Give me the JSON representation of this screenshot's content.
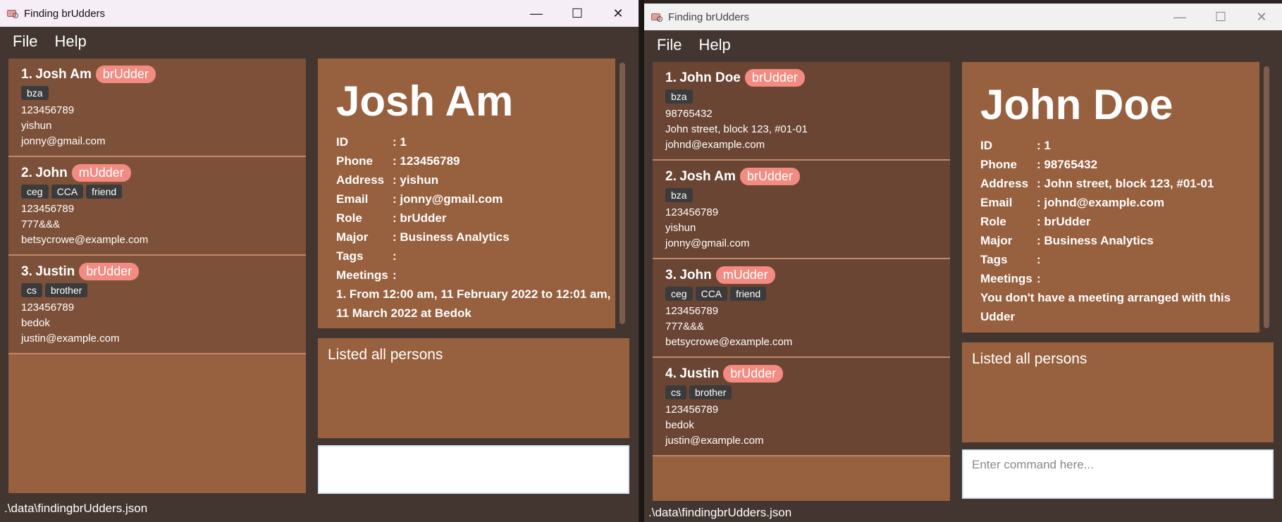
{
  "left": {
    "title": "Finding brUdders",
    "menu": [
      "File",
      "Help"
    ],
    "persons": [
      {
        "num": "1.",
        "name": "Josh Am",
        "role": "brUdder",
        "tags": [
          "bza"
        ],
        "phone": "123456789",
        "address": "yishun",
        "email": "jonny@gmail.com"
      },
      {
        "num": "2.",
        "name": "John",
        "role": "mUdder",
        "tags": [
          "ceg",
          "CCA",
          "friend"
        ],
        "phone": "123456789",
        "address": "777&&&",
        "email": "betsycrowe@example.com"
      },
      {
        "num": "3.",
        "name": "Justin",
        "role": "brUdder",
        "tags": [
          "cs",
          "brother"
        ],
        "phone": "123456789",
        "address": "bedok",
        "email": "justin@example.com"
      }
    ],
    "detail": {
      "name": "Josh Am",
      "rows": [
        {
          "key": "ID",
          "value": ": 1"
        },
        {
          "key": "Phone",
          "value": ": 123456789"
        },
        {
          "key": "Address",
          "value": ": yishun"
        },
        {
          "key": "Email",
          "value": ": jonny@gmail.com"
        },
        {
          "key": "Role",
          "value": ": brUdder"
        },
        {
          "key": "Major",
          "value": ": Business Analytics"
        },
        {
          "key": "Tags",
          "value": ":"
        },
        {
          "key": "Meetings",
          "value": ":"
        }
      ],
      "meeting_text": "1. From 12:00 am, 11 February 2022 to 12:01 am, 11 March 2022 at Bedok"
    },
    "result": "Listed all persons",
    "command_value": "",
    "status": ".\\data\\findingbrUdders.json"
  },
  "right": {
    "title": "Finding brUdders",
    "menu": [
      "File",
      "Help"
    ],
    "persons": [
      {
        "num": "1.",
        "name": "John Doe",
        "role": "brUdder",
        "tags": [
          "bza"
        ],
        "phone": "98765432",
        "address": "John street, block 123, #01-01",
        "email": "johnd@example.com"
      },
      {
        "num": "2.",
        "name": "Josh Am",
        "role": "brUdder",
        "tags": [
          "bza"
        ],
        "phone": "123456789",
        "address": "yishun",
        "email": "jonny@gmail.com"
      },
      {
        "num": "3.",
        "name": "John",
        "role": "mUdder",
        "tags": [
          "ceg",
          "CCA",
          "friend"
        ],
        "phone": "123456789",
        "address": "777&&&",
        "email": "betsycrowe@example.com"
      },
      {
        "num": "4.",
        "name": "Justin",
        "role": "brUdder",
        "tags": [
          "cs",
          "brother"
        ],
        "phone": "123456789",
        "address": "bedok",
        "email": "justin@example.com"
      }
    ],
    "detail": {
      "name": "John Doe",
      "rows": [
        {
          "key": "ID",
          "value": ": 1"
        },
        {
          "key": "Phone",
          "value": ": 98765432"
        },
        {
          "key": "Address",
          "value": ": John street, block 123, #01-01"
        },
        {
          "key": "Email",
          "value": ": johnd@example.com"
        },
        {
          "key": "Role",
          "value": ": brUdder"
        },
        {
          "key": "Major",
          "value": ": Business Analytics"
        },
        {
          "key": "Tags",
          "value": ":"
        },
        {
          "key": "Meetings",
          "value": ":"
        }
      ],
      "meeting_text": "You don't have a meeting arranged with this Udder"
    },
    "result": "Listed all persons",
    "command_placeholder": "Enter command here...",
    "status": ".\\data\\findingbrUdders.json"
  },
  "window_controls": {
    "minimize": "—",
    "maximize": "☐",
    "close": "✕"
  },
  "colors": {
    "panel": "#97603f",
    "card_dark": "#6a4533",
    "badge": "#f28b82",
    "background": "#433630"
  }
}
